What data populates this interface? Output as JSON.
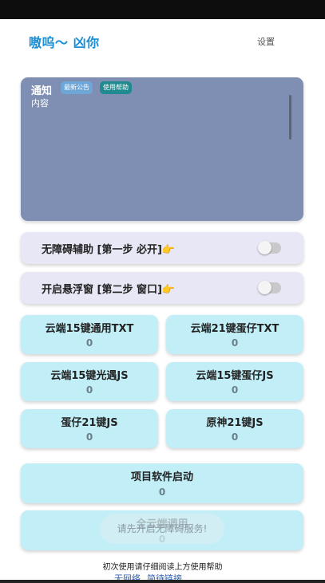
{
  "app": {
    "title": "嗷呜～ 凶你",
    "settings_label": "设置"
  },
  "notice": {
    "title": "通知",
    "tag_latest": "最新公告",
    "tag_help": "使用帮助",
    "content": "内容"
  },
  "toggles": [
    {
      "label": "无障碍辅助 [第一步 必开]👉",
      "on": false
    },
    {
      "label": "开启悬浮窗 [第二步 窗口]👉",
      "on": false
    }
  ],
  "scripts": [
    {
      "name": "云端15键通用TXT",
      "count": "0"
    },
    {
      "name": "云端21键蛋仔TXT",
      "count": "0"
    },
    {
      "name": "云端15键光遇JS",
      "count": "0"
    },
    {
      "name": "云端15键蛋仔JS",
      "count": "0"
    },
    {
      "name": "蛋仔21键JS",
      "count": "0"
    },
    {
      "name": "原神21键JS",
      "count": "0"
    }
  ],
  "project_launch": {
    "name": "项目软件启动",
    "count": "0"
  },
  "all_cloud": {
    "name": "全云端调用",
    "count": "0"
  },
  "toast": "请先开启无障碍服务!",
  "footer": {
    "hint": "初次使用请仔细阅读上方使用帮助",
    "link_network": "无网络",
    "link_easy": "简待链接"
  }
}
